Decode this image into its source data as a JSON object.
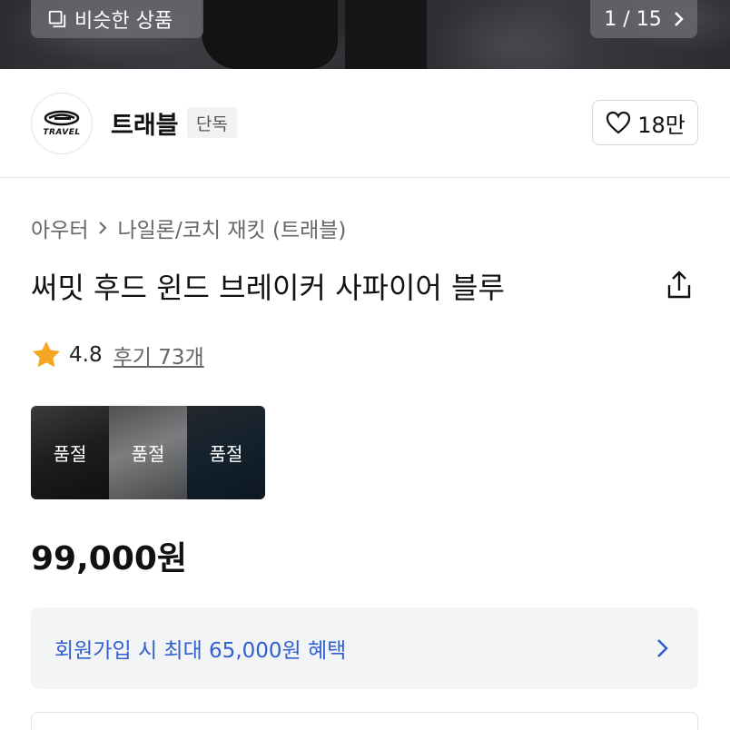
{
  "hero": {
    "similar_label": "비슷한 상품",
    "similar_icon": "similar-items-icon",
    "counter": "1 / 15",
    "counter_icon": "chevron-right-icon"
  },
  "brand": {
    "logo_text": "TRAVEL",
    "name": "트래블",
    "badge": "단독",
    "likes": "18만",
    "like_icon": "heart-icon"
  },
  "product": {
    "breadcrumb": [
      "아우터",
      "나일론/코치 재킷 (트래블)"
    ],
    "title": "써밋 후드 윈드 브레이커 사파이어 블루",
    "share_icon": "share-icon"
  },
  "rating": {
    "value": "4.8",
    "reviews": "후기 73개",
    "star_color": "#f5a623"
  },
  "options": [
    {
      "label": "품절"
    },
    {
      "label": "품절"
    },
    {
      "label": "품절"
    }
  ],
  "price": "99,000원",
  "signup": {
    "text": "회원가입 시 최대 65,000원 혜택",
    "color": "#2f5fd0"
  }
}
